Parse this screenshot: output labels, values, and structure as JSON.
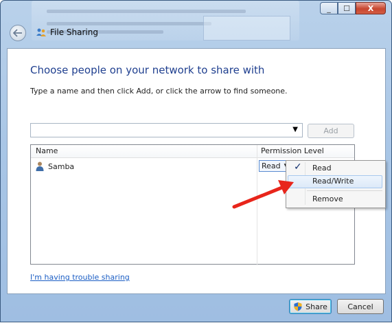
{
  "window": {
    "title": "File Sharing",
    "controls": {
      "minimize": "_",
      "maximize": "☐",
      "close": "X"
    }
  },
  "dialog": {
    "heading": "Choose people on your network to share with",
    "instruction": "Type a name and then click Add, or click the arrow to find someone.",
    "name_input": {
      "value": "",
      "placeholder": ""
    },
    "add_label": "Add",
    "columns": {
      "name": "Name",
      "permission": "Permission Level"
    },
    "users": [
      {
        "name": "Samba",
        "permission": "Read"
      }
    ],
    "permission_menu": [
      {
        "label": "Read",
        "checked": true
      },
      {
        "label": "Read/Write",
        "checked": false
      },
      {
        "label": "Remove",
        "checked": false
      }
    ],
    "trouble_link": "I'm having trouble sharing",
    "share_label": "Share",
    "cancel_label": "Cancel"
  },
  "colors": {
    "heading": "#1f3f8f",
    "link": "#1a5dc4",
    "annotation_arrow": "#e8251b"
  },
  "icons": [
    "back-arrow-icon",
    "homegroup-icon",
    "user-icon",
    "dropdown-arrow-icon",
    "checkmark-icon",
    "uac-shield-icon"
  ]
}
